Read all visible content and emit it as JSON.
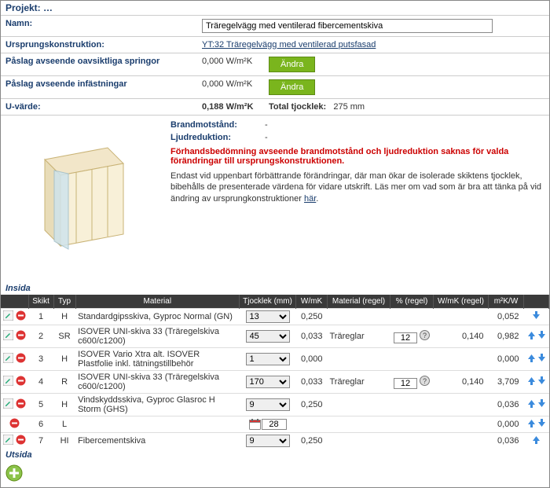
{
  "project_title": "Projekt: …",
  "form": {
    "name_label": "Namn:",
    "name_value": "Träregelvägg med ventilerad fibercementskiva",
    "origin_label": "Ursprungskonstruktion:",
    "origin_link": "YT:32 Träregelvägg med ventilerad putsfasad",
    "paslag_spr_label": "Påslag avseende oavsiktliga springor",
    "paslag_spr_value": "0,000 W/m²K",
    "paslag_inf_label": "Påslag avseende infästningar",
    "paslag_inf_value": "0,000 W/m²K",
    "andra_btn": "Ändra",
    "u_label": "U-värde:",
    "u_value": "0,188 W/m²K",
    "tjock_label": "Total tjocklek:",
    "tjock_value": "275 mm"
  },
  "info": {
    "brand_label": "Brandmotstånd:",
    "brand_value": "-",
    "ljud_label": "Ljudreduktion:",
    "ljud_value": "-",
    "warning": "Förhandsbedömning avseende brandmotstånd och ljudreduktion saknas för valda förändringar till ursprungskonstruktionen.",
    "desc": "Endast vid uppenbart förbättrande förändringar, där man ökar de isolerade skiktens tjocklek, bibehålls de presenterade värdena för vidare utskrift. Läs mer om vad som är bra att tänka på vid ändring av ursprungkonstruktioner ",
    "desc_link": "här"
  },
  "sections": {
    "insida": "Insida",
    "utsida": "Utsida"
  },
  "headers": {
    "skikt": "Skikt",
    "typ": "Typ",
    "material": "Material",
    "tjocklek": "Tjocklek (mm)",
    "wmk": "W/mK",
    "materialregel": "Material (regel)",
    "pctregel": "% (regel)",
    "wmkregel": "W/mK (regel)",
    "m2kw": "m²K/W",
    "blank": ""
  },
  "rows": [
    {
      "edit": true,
      "skikt": "1",
      "typ": "H",
      "material": "Standardgipsskiva, Gyproc Normal (GN)",
      "tjocklek": "13",
      "wmk": "0,250",
      "materialregel": "",
      "pct": "",
      "wmkregel": "",
      "m2kw": "0,052",
      "up": false,
      "down": true,
      "cal": false
    },
    {
      "edit": true,
      "skikt": "2",
      "typ": "SR",
      "material": "ISOVER UNI-skiva 33 (Träregelskiva c600/c1200)",
      "tjocklek": "45",
      "wmk": "0,033",
      "materialregel": "Träreglar",
      "pct": "12",
      "wmkregel": "0,140",
      "m2kw": "0,982",
      "up": true,
      "down": true,
      "cal": false
    },
    {
      "edit": true,
      "skikt": "3",
      "typ": "H",
      "material": "ISOVER Vario Xtra alt. ISOVER Plastfolie inkl. tätningstillbehör",
      "tjocklek": "1",
      "wmk": "0,000",
      "materialregel": "",
      "pct": "",
      "wmkregel": "",
      "m2kw": "0,000",
      "up": true,
      "down": true,
      "cal": false
    },
    {
      "edit": true,
      "skikt": "4",
      "typ": "R",
      "material": "ISOVER UNI-skiva 33 (Träregelskiva c600/c1200)",
      "tjocklek": "170",
      "wmk": "0,033",
      "materialregel": "Träreglar",
      "pct": "12",
      "wmkregel": "0,140",
      "m2kw": "3,709",
      "up": true,
      "down": true,
      "cal": false
    },
    {
      "edit": true,
      "skikt": "5",
      "typ": "H",
      "material": "Vindskyddsskiva, Gyproc Glasroc H Storm (GHS)",
      "tjocklek": "9",
      "wmk": "0,250",
      "materialregel": "",
      "pct": "",
      "wmkregel": "",
      "m2kw": "0,036",
      "up": true,
      "down": true,
      "cal": false
    },
    {
      "edit": false,
      "skikt": "6",
      "typ": "L",
      "material": "",
      "tjocklek": "28",
      "wmk": "",
      "materialregel": "",
      "pct": "",
      "wmkregel": "",
      "m2kw": "0,000",
      "up": true,
      "down": true,
      "cal": true
    },
    {
      "edit": true,
      "skikt": "7",
      "typ": "HI",
      "material": "Fibercementskiva",
      "tjocklek": "9",
      "wmk": "0,250",
      "materialregel": "",
      "pct": "",
      "wmkregel": "",
      "m2kw": "0,036",
      "up": true,
      "down": false,
      "cal": false
    }
  ]
}
